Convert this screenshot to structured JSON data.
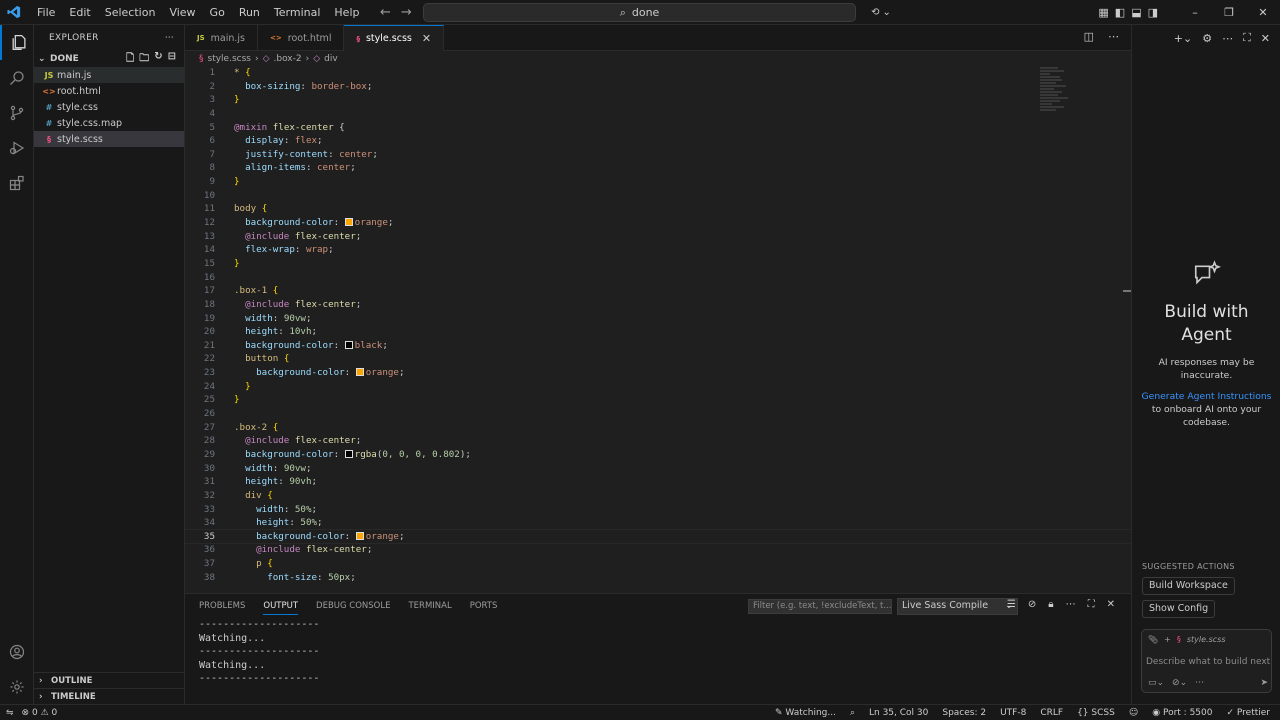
{
  "titlebar": {
    "menu": [
      "File",
      "Edit",
      "Selection",
      "View",
      "Go",
      "Run",
      "Terminal",
      "Help"
    ],
    "search_text": "done"
  },
  "explorer": {
    "title": "EXPLORER",
    "folder": "DONE",
    "files": [
      {
        "name": "main.js",
        "icon": "JS",
        "icon_color": "#cbcb41"
      },
      {
        "name": "root.html",
        "icon": "<>",
        "icon_color": "#e37933"
      },
      {
        "name": "style.css",
        "icon": "#",
        "icon_color": "#519aba"
      },
      {
        "name": "style.css.map",
        "icon": "#",
        "icon_color": "#519aba"
      },
      {
        "name": "style.scss",
        "icon": "§",
        "icon_color": "#f55385"
      }
    ],
    "outline": "OUTLINE",
    "timeline": "TIMELINE"
  },
  "tabs": [
    {
      "name": "main.js",
      "icon": "JS",
      "icon_color": "#cbcb41"
    },
    {
      "name": "root.html",
      "icon": "<>",
      "icon_color": "#e37933"
    },
    {
      "name": "style.scss",
      "icon": "§",
      "icon_color": "#f55385",
      "active": true
    }
  ],
  "breadcrumb": [
    "style.scss",
    ".box-2",
    "div"
  ],
  "code_lines": [
    "* {",
    "  box-sizing: border-box;",
    "}",
    "",
    "@mixin flex-center {",
    "  display: flex;",
    "  justify-content: center;",
    "  align-items: center;",
    "}",
    "",
    "body {",
    "  background-color: orange;",
    "  @include flex-center;",
    "  flex-wrap: wrap;",
    "}",
    "",
    ".box-1 {",
    "  @include flex-center;",
    "  width: 90vw;",
    "  height: 10vh;",
    "  background-color: black;",
    "  button {",
    "    background-color: orange;",
    "  }",
    "}",
    "",
    ".box-2 {",
    "  @include flex-center;",
    "  background-color: rgba(0, 0, 0, 0.802);",
    "  width: 90vw;",
    "  height: 90vh;",
    "  div {",
    "    width: 50%;",
    "    height: 50%;",
    "    background-color: orange;",
    "    @include flex-center;",
    "    p {",
    "      font-size: 50px;"
  ],
  "current_line": 35,
  "panel": {
    "tabs": [
      "PROBLEMS",
      "OUTPUT",
      "DEBUG CONSOLE",
      "TERMINAL",
      "PORTS"
    ],
    "active_tab": "OUTPUT",
    "filter_placeholder": "Filter (e.g. text, !excludeText, t...",
    "channel": "Live Sass Compile",
    "output_lines": [
      "--------------------",
      "Watching...",
      "--------------------",
      "Watching...",
      "--------------------"
    ]
  },
  "chat": {
    "title_line1": "Build with",
    "title_line2": "Agent",
    "disclaimer": "AI responses may be inaccurate.",
    "link_text": "Generate Agent Instructions",
    "link_suffix": " to onboard AI onto your codebase.",
    "suggested_label": "SUGGESTED ACTIONS",
    "actions": [
      "Build Workspace",
      "Show Config"
    ],
    "context_file": "style.scss",
    "input_placeholder": "Describe what to build next"
  },
  "status": {
    "errors": "0",
    "warnings": "0",
    "watching": "Watching...",
    "position": "Ln 35, Col 30",
    "spaces": "Spaces: 2",
    "encoding": "UTF-8",
    "eol": "CRLF",
    "language": "SCSS",
    "port": "Port : 5500",
    "prettier": "Prettier"
  },
  "colors": {
    "accent": "#0078d4",
    "orange_swatch": "#ffa500",
    "black_swatch": "#000000"
  }
}
